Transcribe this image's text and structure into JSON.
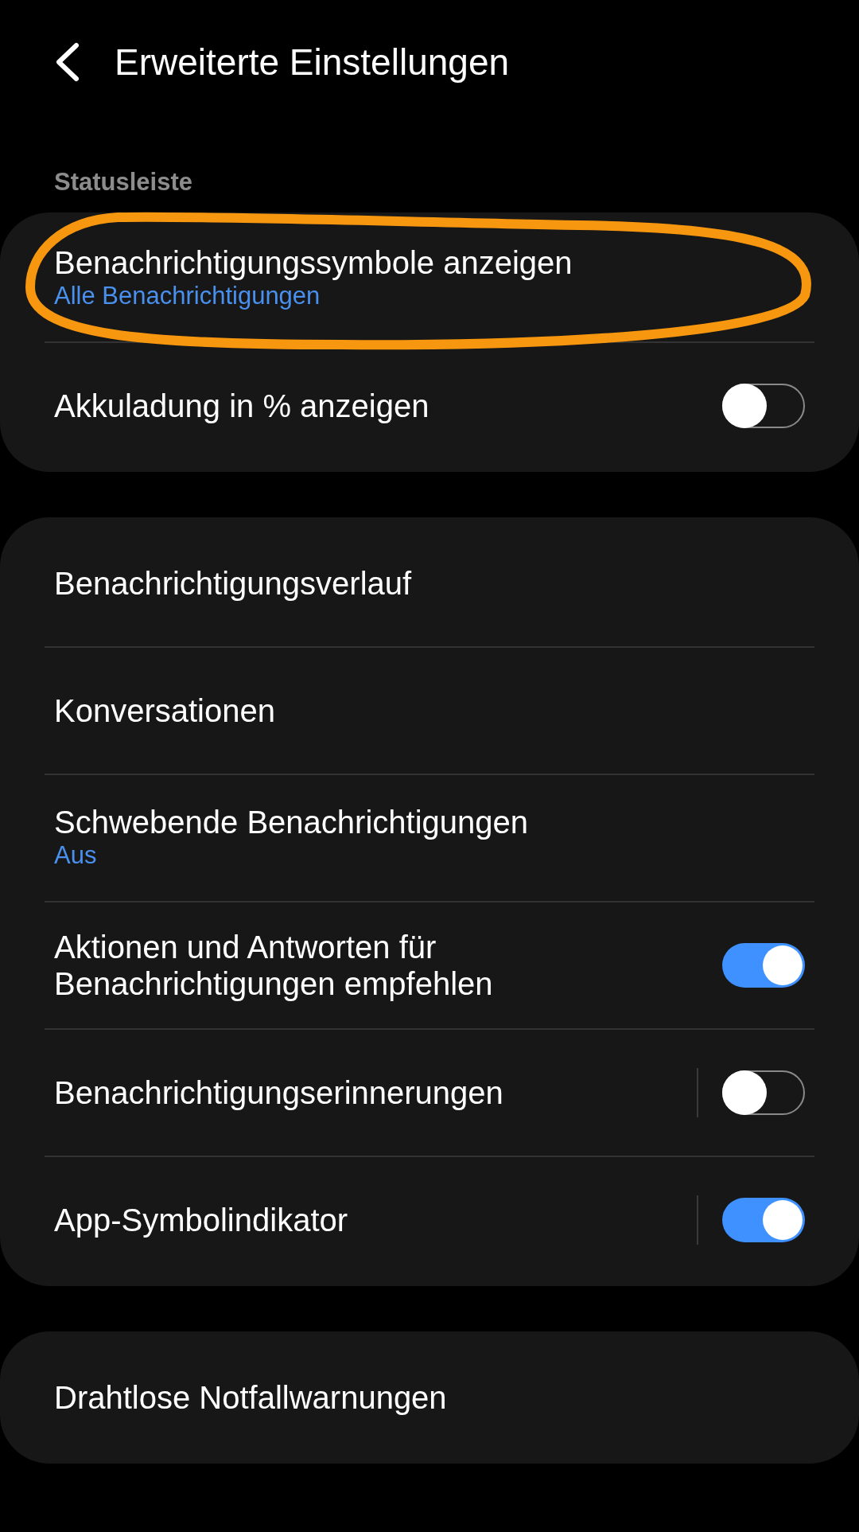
{
  "header": {
    "title": "Erweiterte Einstellungen"
  },
  "sections": [
    {
      "heading": "Statusleiste",
      "items": [
        {
          "kind": "link",
          "title": "Benachrichtigungssymbole anzeigen",
          "subtitle": "Alle Benachrichtigungen",
          "highlighted": true
        },
        {
          "kind": "switch",
          "title": "Akkuladung in % anzeigen",
          "on": false
        }
      ]
    },
    {
      "items": [
        {
          "kind": "link",
          "title": "Benachrichtigungsverlauf"
        },
        {
          "kind": "link",
          "title": "Konversationen"
        },
        {
          "kind": "link",
          "title": "Schwebende Benachrichtigungen",
          "subtitle": "Aus"
        },
        {
          "kind": "switch",
          "title": "Aktionen und Antworten für Benachrichtigungen empfehlen",
          "on": true
        },
        {
          "kind": "split-switch",
          "title": "Benachrichtigungserinnerungen",
          "on": false
        },
        {
          "kind": "split-switch",
          "title": "App-Symbolindikator",
          "on": true
        }
      ]
    },
    {
      "items": [
        {
          "kind": "link",
          "title": "Drahtlose Notfallwarnungen"
        }
      ]
    }
  ]
}
